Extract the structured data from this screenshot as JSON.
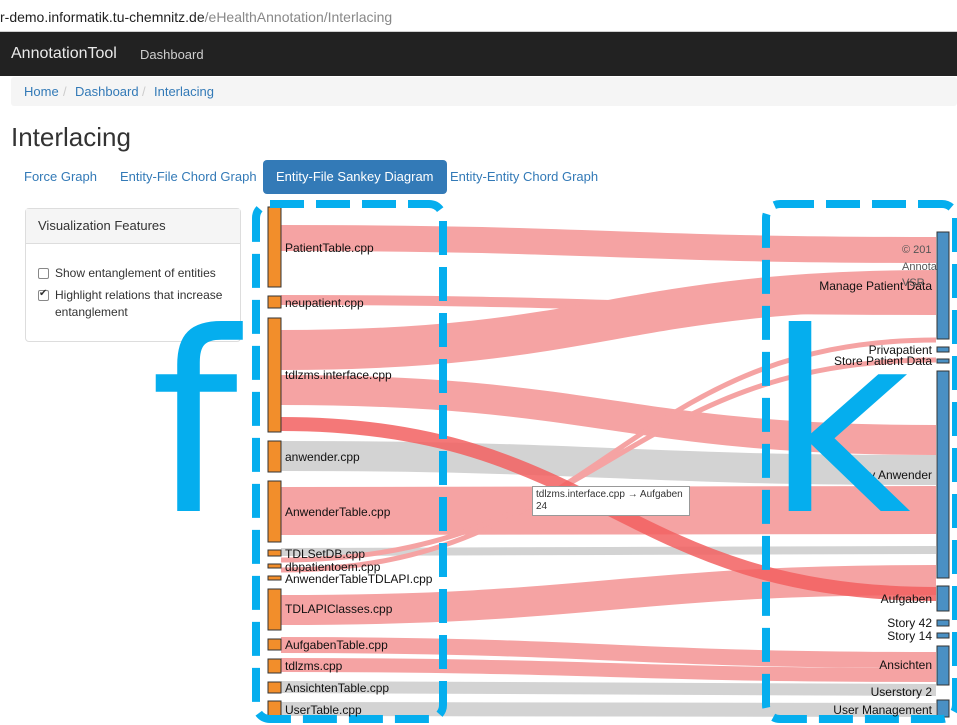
{
  "browser": {
    "url_host": "r-demo.informatik.tu-chemnitz.de",
    "url_path": "/eHealthAnnotation/Interlacing"
  },
  "navbar": {
    "brand": "AnnotationTool",
    "dashboard": "Dashboard"
  },
  "breadcrumb": {
    "home": "Home",
    "dashboard": "Dashboard",
    "current": "Interlacing",
    "separator": "/"
  },
  "page_title": "Interlacing",
  "tabs": [
    {
      "label": "Force Graph"
    },
    {
      "label": "Entity-File Chord Graph"
    },
    {
      "label": "Entity-File Sankey Diagram",
      "active": true
    },
    {
      "label": "Entity-Entity Chord Graph"
    }
  ],
  "panel": {
    "title": "Visualization Features",
    "options": [
      {
        "label": "Show entanglement of entities",
        "checked": false
      },
      {
        "label": "Highlight relations that increase",
        "label2": "entanglement",
        "checked": true
      }
    ]
  },
  "sankey": {
    "files": [
      "PatientTable.cpp",
      "neupatient.cpp",
      "tdlzms.interface.cpp",
      "anwender.cpp",
      "AnwenderTable.cpp",
      "TDLSetDB.cpp",
      "dbpatientoem.cpp",
      "AnwenderTableTDLAPI.cpp",
      "TDLAPIClasses.cpp",
      "AufgabenTable.cpp",
      "tdlzms.cpp",
      "AnsichtenTable.cpp",
      "UserTable.cpp"
    ],
    "entities": [
      "Manage Patient Data",
      "Privapatient",
      "Store Patient Data",
      "Story Anwender",
      "Aufgaben",
      "Story 42",
      "Story 14",
      "Ansichten",
      "Userstory 2",
      "User Management"
    ],
    "tooltip": {
      "relation": "tdlzms.interface.cpp → Aufgaben",
      "value": "24"
    },
    "copyright": {
      "line1": "© 201",
      "line2": "Annota",
      "line3": "VSR"
    }
  },
  "overlay": {
    "left_letter": "f",
    "right_letter": "k"
  },
  "colors": {
    "accent": "#337ab7",
    "file_node": "#f28e2b",
    "entity_node": "#4a90c4",
    "flow": "#f5a3a3",
    "highlight": "#05aeee"
  }
}
